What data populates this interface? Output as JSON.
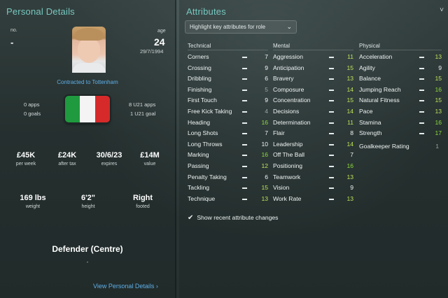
{
  "left": {
    "title": "Personal Details",
    "no_label": "no.",
    "no_value": "-",
    "age_label": "age",
    "age_value": "24",
    "dob": "29/7/1994",
    "contract": "Contracted to Tottenham",
    "apps": "0 apps",
    "goals": "0 goals",
    "u21_apps": "8 U21 apps",
    "u21_goals": "1 U21 goal",
    "flag_colors": [
      "#1f9a3e",
      "#f4f4f4",
      "#d62a2a"
    ],
    "wage": {
      "value": "£45K",
      "label": "per week"
    },
    "after_tax": {
      "value": "£24K",
      "label": "after tax"
    },
    "expires": {
      "value": "30/6/23",
      "label": "expires"
    },
    "value": {
      "value": "£14M",
      "label": "value"
    },
    "weight": {
      "value": "169 lbs",
      "label": "weight"
    },
    "height": {
      "value": "6'2\"",
      "label": "height"
    },
    "footed": {
      "value": "Right",
      "label": "footed"
    },
    "position": "Defender (Centre)",
    "position_sub": "-",
    "view_link": "View Personal Details ›"
  },
  "right": {
    "title": "Attributes",
    "dropdown": "Highlight key attributes for role",
    "collapse": "˅",
    "checkbox_label": "Show recent attribute changes",
    "columns": [
      {
        "head": "Technical",
        "rows": [
          {
            "name": "Corners",
            "value": "7"
          },
          {
            "name": "Crossing",
            "value": "9"
          },
          {
            "name": "Dribbling",
            "value": "6"
          },
          {
            "name": "Finishing",
            "value": "5"
          },
          {
            "name": "First Touch",
            "value": "9"
          },
          {
            "name": "Free Kick Taking",
            "value": "4"
          },
          {
            "name": "Heading",
            "value": "16"
          },
          {
            "name": "Long Shots",
            "value": "7"
          },
          {
            "name": "Long Throws",
            "value": "10"
          },
          {
            "name": "Marking",
            "value": "16"
          },
          {
            "name": "Passing",
            "value": "12"
          },
          {
            "name": "Penalty Taking",
            "value": "6"
          },
          {
            "name": "Tackling",
            "value": "15"
          },
          {
            "name": "Technique",
            "value": "13"
          }
        ]
      },
      {
        "head": "Mental",
        "rows": [
          {
            "name": "Aggression",
            "value": "11"
          },
          {
            "name": "Anticipation",
            "value": "15"
          },
          {
            "name": "Bravery",
            "value": "13"
          },
          {
            "name": "Composure",
            "value": "14"
          },
          {
            "name": "Concentration",
            "value": "15"
          },
          {
            "name": "Decisions",
            "value": "14"
          },
          {
            "name": "Determination",
            "value": "11"
          },
          {
            "name": "Flair",
            "value": "8"
          },
          {
            "name": "Leadership",
            "value": "14"
          },
          {
            "name": "Off The Ball",
            "value": "7"
          },
          {
            "name": "Positioning",
            "value": "16"
          },
          {
            "name": "Teamwork",
            "value": "13"
          },
          {
            "name": "Vision",
            "value": "9"
          },
          {
            "name": "Work Rate",
            "value": "13"
          }
        ]
      },
      {
        "head": "Physical",
        "rows": [
          {
            "name": "Acceleration",
            "value": "13"
          },
          {
            "name": "Agility",
            "value": "9"
          },
          {
            "name": "Balance",
            "value": "15"
          },
          {
            "name": "Jumping Reach",
            "value": "16"
          },
          {
            "name": "Natural Fitness",
            "value": "15"
          },
          {
            "name": "Pace",
            "value": "13"
          },
          {
            "name": "Stamina",
            "value": "16"
          },
          {
            "name": "Strength",
            "value": "17"
          }
        ]
      }
    ],
    "goalkeeper_label": "Goalkeeper Rating",
    "goalkeeper_value": "1"
  },
  "colors": {
    "accent_title": "#77c8c0",
    "link": "#5fb0ea",
    "val_low": "#9aa3a3",
    "val_mid": "#f2f4f4",
    "val_high": "#bfe35a",
    "val_top": "#8fdc3c"
  }
}
